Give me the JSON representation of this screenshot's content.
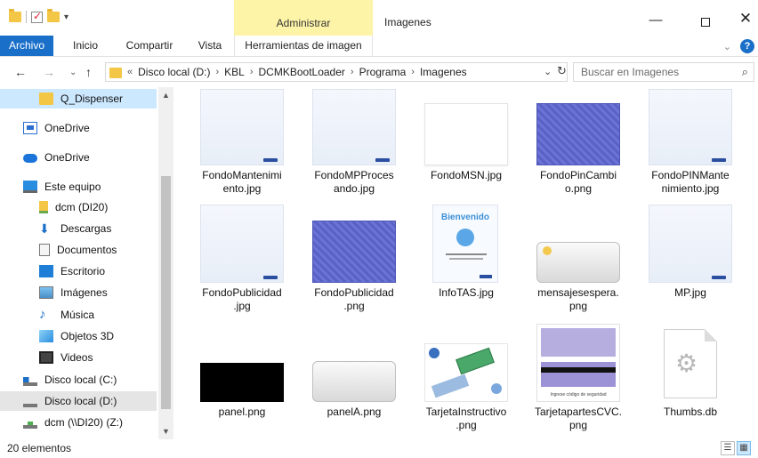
{
  "window": {
    "title": "Imagenes",
    "manage_tab": "Administrar",
    "min": "—",
    "max": "",
    "close": "✕"
  },
  "ribbon": {
    "tabs": [
      "Archivo",
      "Inicio",
      "Compartir",
      "Vista",
      "Herramientas de imagen"
    ]
  },
  "address": {
    "prefix": "«",
    "crumbs": [
      "Disco local (D:)",
      "KBL",
      "DCMKBootLoader",
      "Programa",
      "Imagenes"
    ],
    "separator": "›"
  },
  "search": {
    "placeholder": "Buscar en Imagenes"
  },
  "nav": {
    "items": [
      {
        "label": "Q_Dispenser",
        "icon": "folder-icon"
      },
      {
        "label": "OneDrive",
        "icon": "onedrive-business-icon"
      },
      {
        "label": "OneDrive",
        "icon": "onedrive-icon"
      },
      {
        "label": "Este equipo",
        "icon": "computer-icon"
      },
      {
        "label": "dcm (DI20)",
        "icon": "user-folder-icon"
      },
      {
        "label": "Descargas",
        "icon": "download-icon"
      },
      {
        "label": "Documentos",
        "icon": "documents-icon"
      },
      {
        "label": "Escritorio",
        "icon": "desktop-icon"
      },
      {
        "label": "Imágenes",
        "icon": "pictures-icon"
      },
      {
        "label": "Música",
        "icon": "music-icon"
      },
      {
        "label": "Objetos 3D",
        "icon": "objects3d-icon"
      },
      {
        "label": "Videos",
        "icon": "videos-icon"
      },
      {
        "label": "Disco local (C:)",
        "icon": "drive-c-icon"
      },
      {
        "label": "Disco local (D:)",
        "icon": "drive-d-icon"
      },
      {
        "label": "dcm (\\\\DI20) (Z:)",
        "icon": "network-drive-icon"
      }
    ]
  },
  "files": [
    {
      "name": "FondoMantenimiento.jpg",
      "line1": "FondoMantenimi",
      "line2": "ento.jpg",
      "thumb": "doc"
    },
    {
      "name": "FondoMPProcesando.jpg",
      "line1": "FondoMPProces",
      "line2": "ando.jpg",
      "thumb": "doc"
    },
    {
      "name": "FondoMSN.jpg",
      "line1": "FondoMSN.jpg",
      "line2": "",
      "thumb": "white"
    },
    {
      "name": "FondoPinCambio.png",
      "line1": "FondoPinCambi",
      "line2": "o.png",
      "thumb": "blue"
    },
    {
      "name": "FondoPINMantenimiento.jpg",
      "line1": "FondoPINMante",
      "line2": "nimiento.jpg",
      "thumb": "doc"
    },
    {
      "name": "FondoPublicidad.jpg",
      "line1": "FondoPublicidad",
      "line2": ".jpg",
      "thumb": "doc"
    },
    {
      "name": "FondoPublicidad.png",
      "line1": "FondoPublicidad",
      "line2": ".png",
      "thumb": "blue"
    },
    {
      "name": "InfoTAS.jpg",
      "line1": "InfoTAS.jpg",
      "line2": "",
      "thumb": "info"
    },
    {
      "name": "mensajesespera.png",
      "line1": "mensajesespera.",
      "line2": "png",
      "thumb": "msg"
    },
    {
      "name": "MP.jpg",
      "line1": "MP.jpg",
      "line2": "",
      "thumb": "doc"
    },
    {
      "name": "panel.png",
      "line1": "panel.png",
      "line2": "",
      "thumb": "black"
    },
    {
      "name": "panelA.png",
      "line1": "panelA.png",
      "line2": "",
      "thumb": "grey"
    },
    {
      "name": "TarjetaInstructivo.png",
      "line1": "TarjetaInstructivo",
      "line2": ".png",
      "thumb": "card"
    },
    {
      "name": "TarjetapartesCVC.png",
      "line1": "TarjetapartesCVC.",
      "line2": "png",
      "thumb": "cvc"
    },
    {
      "name": "Thumbs.db",
      "line1": "Thumbs.db",
      "line2": "",
      "thumb": "db"
    }
  ],
  "thumb_text": {
    "infotas_title": "Bienvenido",
    "cvc_caption": "Ingrese código de seguridad"
  },
  "status": {
    "count": "20 elementos"
  },
  "colors": {
    "accent": "#1a6fc9",
    "manage": "#fef4a8",
    "selected": "#cce8ff"
  }
}
